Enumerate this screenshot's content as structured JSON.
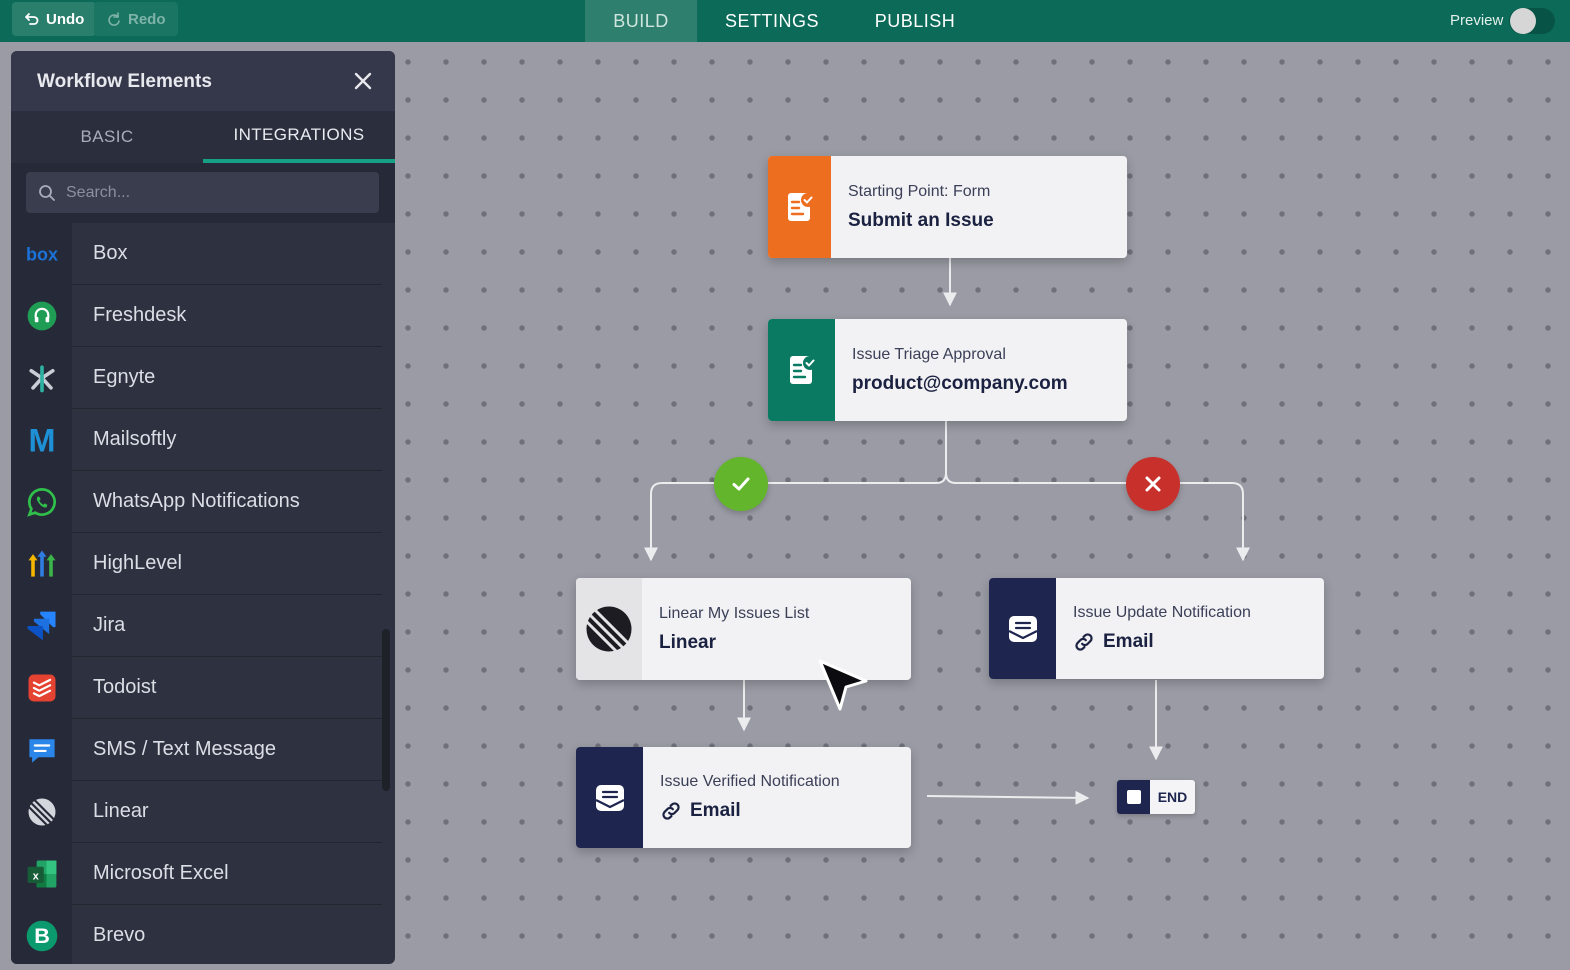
{
  "topbar": {
    "undo_label": "Undo",
    "redo_label": "Redo",
    "tabs": [
      {
        "label": "BUILD",
        "active": true
      },
      {
        "label": "SETTINGS",
        "active": false
      },
      {
        "label": "PUBLISH",
        "active": false
      }
    ],
    "preview_label": "Preview",
    "preview_enabled": false
  },
  "panel": {
    "title": "Workflow Elements",
    "tabs": [
      {
        "label": "BASIC",
        "active": false
      },
      {
        "label": "INTEGRATIONS",
        "active": true
      }
    ],
    "search_placeholder": "Search...",
    "search_value": "",
    "integrations": [
      {
        "label": "Box",
        "icon": "box-icon"
      },
      {
        "label": "Freshdesk",
        "icon": "freshdesk-icon"
      },
      {
        "label": "Egnyte",
        "icon": "egnyte-icon"
      },
      {
        "label": "Mailsoftly",
        "icon": "mailsoftly-icon"
      },
      {
        "label": "WhatsApp Notifications",
        "icon": "whatsapp-icon"
      },
      {
        "label": "HighLevel",
        "icon": "highlevel-icon"
      },
      {
        "label": "Jira",
        "icon": "jira-icon"
      },
      {
        "label": "Todoist",
        "icon": "todoist-icon"
      },
      {
        "label": "SMS / Text Message",
        "icon": "sms-icon"
      },
      {
        "label": "Linear",
        "icon": "linear-icon"
      },
      {
        "label": "Microsoft Excel",
        "icon": "excel-icon"
      },
      {
        "label": "Brevo",
        "icon": "brevo-icon"
      }
    ]
  },
  "workflow": {
    "start": {
      "subtitle": "Starting Point: Form",
      "title": "Submit an Issue",
      "color": "#ee6e1f"
    },
    "approval": {
      "subtitle": "Issue Triage Approval",
      "title": "product@company.com",
      "color": "#0b7a63"
    },
    "linear": {
      "subtitle": "Linear My Issues List",
      "title": "Linear"
    },
    "update": {
      "subtitle": "Issue Update Notification",
      "title": "Email",
      "color": "#1e2650"
    },
    "verified": {
      "subtitle": "Issue Verified Notification",
      "title": "Email",
      "color": "#1e2650"
    },
    "end_label": "END",
    "approve_color": "#63b52b",
    "reject_color": "#c8302c"
  }
}
